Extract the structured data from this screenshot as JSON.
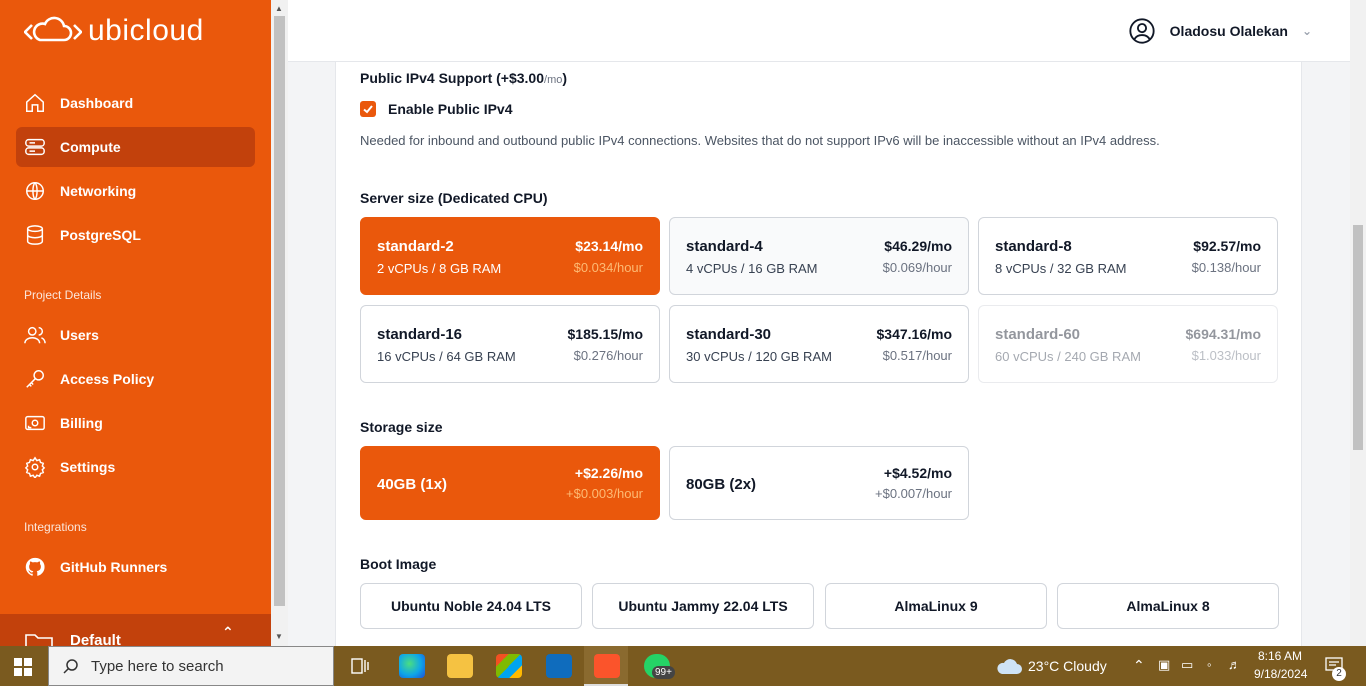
{
  "brand": {
    "name": "ubicloud"
  },
  "nav": {
    "items": [
      {
        "label": "Dashboard",
        "icon": "home-icon"
      },
      {
        "label": "Compute",
        "icon": "server-icon"
      },
      {
        "label": "Networking",
        "icon": "globe-icon"
      },
      {
        "label": "PostgreSQL",
        "icon": "database-icon"
      }
    ],
    "project_label": "Project Details",
    "project_items": [
      {
        "label": "Users",
        "icon": "users-icon"
      },
      {
        "label": "Access Policy",
        "icon": "key-icon"
      },
      {
        "label": "Billing",
        "icon": "banknote-icon"
      },
      {
        "label": "Settings",
        "icon": "gear-icon"
      }
    ],
    "integrations_label": "Integrations",
    "integration_items": [
      {
        "label": "GitHub Runners",
        "icon": "github-icon"
      }
    ],
    "project_switcher": "Default"
  },
  "header": {
    "user_name": "Oladosu Olalekan"
  },
  "ipv4": {
    "title": "Public IPv4 Support (+$3.00",
    "title_unit": "/mo",
    "title_close": ")",
    "checkbox_label": "Enable Public IPv4",
    "checked": true,
    "help": "Needed for inbound and outbound public IPv4 connections. Websites that do not support IPv6 will be inaccessible without an IPv4 address."
  },
  "server_size": {
    "title": "Server size (Dedicated CPU)",
    "options": [
      {
        "name": "standard-2",
        "spec": "2 vCPUs / 8 GB RAM",
        "monthly": "$23.14/mo",
        "hourly": "$0.034/hour",
        "selected": true
      },
      {
        "name": "standard-4",
        "spec": "4 vCPUs / 16 GB RAM",
        "monthly": "$46.29/mo",
        "hourly": "$0.069/hour"
      },
      {
        "name": "standard-8",
        "spec": "8 vCPUs / 32 GB RAM",
        "monthly": "$92.57/mo",
        "hourly": "$0.138/hour"
      },
      {
        "name": "standard-16",
        "spec": "16 vCPUs / 64 GB RAM",
        "monthly": "$185.15/mo",
        "hourly": "$0.276/hour"
      },
      {
        "name": "standard-30",
        "spec": "30 vCPUs / 120 GB RAM",
        "monthly": "$347.16/mo",
        "hourly": "$0.517/hour"
      },
      {
        "name": "standard-60",
        "spec": "60 vCPUs / 240 GB RAM",
        "monthly": "$694.31/mo",
        "hourly": "$1.033/hour",
        "disabled": true
      }
    ]
  },
  "storage": {
    "title": "Storage size",
    "options": [
      {
        "name": "40GB (1x)",
        "monthly": "+$2.26/mo",
        "hourly": "+$0.003/hour",
        "selected": true
      },
      {
        "name": "80GB (2x)",
        "monthly": "+$4.52/mo",
        "hourly": "+$0.007/hour"
      }
    ]
  },
  "boot": {
    "title": "Boot Image",
    "options": [
      "Ubuntu Noble 24.04 LTS",
      "Ubuntu Jammy 22.04 LTS",
      "AlmaLinux 9",
      "AlmaLinux 8"
    ]
  },
  "taskbar": {
    "search_placeholder": "Type here to search",
    "badge": "99+",
    "weather": "23°C  Cloudy",
    "time": "8:16 AM",
    "date": "9/18/2024",
    "notifications": "2"
  },
  "colors": {
    "accent": "#ea580c",
    "accent_dark": "#c2410c"
  }
}
